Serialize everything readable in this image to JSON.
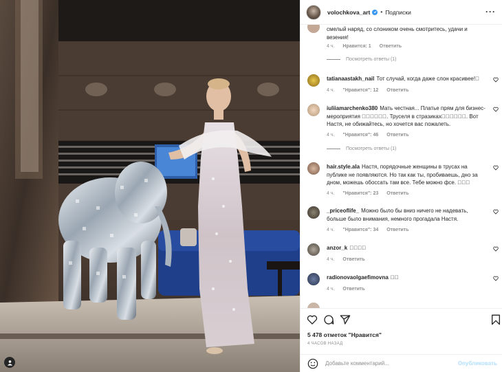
{
  "header": {
    "username": "volochkova_art",
    "separator": "•",
    "follow_label": "Подписки",
    "more_label": "···"
  },
  "first_comment": {
    "text": "смелый наряд, со слоником очень смотритесь, удачи и везения!",
    "time": "4 ч.",
    "likes": "Нравится: 1",
    "reply": "Ответить",
    "view_replies": "Посмотреть ответы (1)"
  },
  "comments": [
    {
      "user": "tatianaastakh_nail",
      "text": "Тот случай, когда даже слон красивее!\u0000",
      "time": "4 ч.",
      "likes": "\"Нравится\": 12",
      "reply": "Ответить"
    },
    {
      "user": "iuliiamarchenko380",
      "text": "Мать честная... Платье прям для бизнес-мероприятия \u0000\u0000\u0000\u0000\u0000\u0000. Труселя в стразиках\u0000\u0000\u0000\u0000\u0000\u0000. Вот Настя, не обижайтесь, но хочется вас пожалеть.",
      "time": "4 ч.",
      "likes": "\"Нравится\": 46",
      "reply": "Ответить",
      "view_replies": "Посмотреть ответы (1)"
    },
    {
      "user": "hair.style.ala",
      "text": "Настя, порядочные женщины в трусах на публике не появляются. Но так как ты, пробиваешь, дно за дном, можешь обоссать там все. Тебе можно фсе. \u0000\u0000\u0000",
      "time": "4 ч.",
      "likes": "\"Нравится\": 23",
      "reply": "Ответить"
    },
    {
      "user": "_priceoflife_",
      "text": "Можно было бы вниз ничего не надевать, больше было внимания, немного прогадала Настя.",
      "time": "4 ч.",
      "likes": "\"Нравится\": 34",
      "reply": "Ответить"
    },
    {
      "user": "anzor_k",
      "text": "\u0000\u0000\u0000\u0000",
      "time": "4 ч.",
      "likes": "",
      "reply": "Ответить"
    },
    {
      "user": "radionovaolgaefimovna",
      "text": "\u0000\u0000",
      "time": "4 ч.",
      "likes": "",
      "reply": "Ответить"
    }
  ],
  "footer": {
    "likes": "5 478 отметок \"Нравится\"",
    "time": "4 ЧАСОВ НАЗАД",
    "comment_placeholder": "Добавьте комментарий...",
    "publish_label": "Опубликовать"
  },
  "colors": {
    "accent": "#3897f0",
    "text": "#262626",
    "muted": "#8e8e8e",
    "border": "#efefef",
    "publish_disabled": "#b2dffc"
  },
  "icons": [
    "user-tag-icon",
    "verified-badge-icon",
    "more-options-icon",
    "heart-icon",
    "comment-icon",
    "share-icon",
    "bookmark-icon",
    "emoji-icon"
  ]
}
